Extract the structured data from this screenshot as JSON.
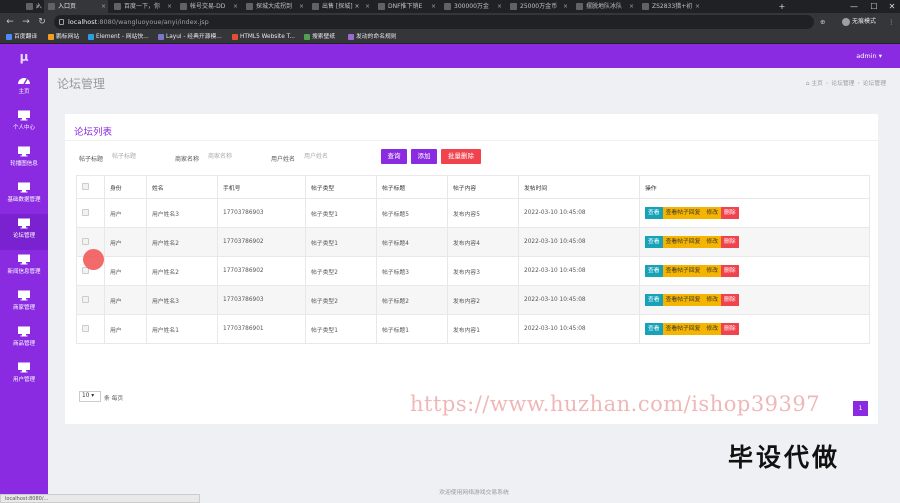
{
  "browser": {
    "tabs": [
      {
        "label": "入口页",
        "active": false
      },
      {
        "label": "入口页",
        "active": true
      },
      {
        "label": "百度一下，你",
        "active": false
      },
      {
        "label": "帐号交易-DD",
        "active": false
      },
      {
        "label": "探城大成拐到",
        "active": false
      },
      {
        "label": "出售 [探城] ×",
        "active": false
      },
      {
        "label": "DNF推下销E",
        "active": false
      },
      {
        "label": "300000万金",
        "active": false
      },
      {
        "label": "25000万金币",
        "active": false
      },
      {
        "label": "摆脱地队冰队",
        "active": false
      },
      {
        "label": "ZS2833猎+初",
        "active": false
      }
    ],
    "url_host": "localhost",
    "url_path": ":8080/wangluoyoue/anyi/index.jsp",
    "profile_label": "无痕模式",
    "bookmarks": [
      "百度翻译",
      "鹏标网站",
      "Element - 网站快...",
      "Layui - 经典开源模...",
      "HTML5 Website T...",
      "搜索壁纸",
      "发动的命名规则"
    ]
  },
  "sidebar": {
    "brand": "μ",
    "items": [
      {
        "label": "主页",
        "icon": "dashboard-icon"
      },
      {
        "label": "个人中心",
        "icon": "monitor-icon"
      },
      {
        "label": "轮播图信息",
        "icon": "monitor-icon"
      },
      {
        "label": "基础数据管理",
        "icon": "monitor-icon"
      },
      {
        "label": "论坛管理",
        "icon": "monitor-icon"
      },
      {
        "label": "新闻信息管理",
        "icon": "monitor-icon"
      },
      {
        "label": "商家管理",
        "icon": "monitor-icon"
      },
      {
        "label": "商品管理",
        "icon": "monitor-icon"
      },
      {
        "label": "用户管理",
        "icon": "monitor-icon"
      }
    ]
  },
  "header": {
    "admin_label": "admin ▾",
    "page_title": "论坛管理",
    "breadcrumb": [
      "主页",
      "论坛管理",
      "论坛管理"
    ]
  },
  "panel": {
    "title": "论坛列表",
    "filters": [
      {
        "label": "帖子标题",
        "placeholder": "帖子标题"
      },
      {
        "label": "商家名称",
        "placeholder": "商家名称"
      },
      {
        "label": "用户姓名",
        "placeholder": "用户姓名"
      }
    ],
    "buttons": {
      "search": "查询",
      "add": "添加",
      "batch_delete": "批量删除"
    }
  },
  "table": {
    "columns": [
      "",
      "身份",
      "姓名",
      "手机号",
      "帖子类型",
      "帖子标题",
      "帖子内容",
      "发帖时间",
      "操作"
    ],
    "rows": [
      {
        "role": "用户",
        "name": "用户姓名3",
        "phone": "17703786903",
        "type": "帖子类型1",
        "title": "帖子标题5",
        "content": "发布内容5",
        "time": "2022-03-10 10:45:08"
      },
      {
        "role": "用户",
        "name": "用户姓名2",
        "phone": "17703786902",
        "type": "帖子类型1",
        "title": "帖子标题4",
        "content": "发布内容4",
        "time": "2022-03-10 10:45:08"
      },
      {
        "role": "用户",
        "name": "用户姓名2",
        "phone": "17703786902",
        "type": "帖子类型2",
        "title": "帖子标题3",
        "content": "发布内容3",
        "time": "2022-03-10 10:45:08"
      },
      {
        "role": "用户",
        "name": "用户姓名3",
        "phone": "17703786903",
        "type": "帖子类型2",
        "title": "帖子标题2",
        "content": "发布内容2",
        "time": "2022-03-10 10:45:08"
      },
      {
        "role": "用户",
        "name": "用户姓名1",
        "phone": "17703786901",
        "type": "帖子类型1",
        "title": "帖子标题1",
        "content": "发布内容1",
        "time": "2022-03-10 10:45:08"
      }
    ],
    "actions": {
      "view": "查看",
      "reply": "查看帖子回复",
      "edit": "修改",
      "delete": "删除"
    }
  },
  "pagination": {
    "page_size": "10",
    "per_page_label": "条 每页",
    "current_page": "1"
  },
  "footer": "欢迎使用网络游戏交易系统",
  "watermark": "https://www.huzhan.com/ishop39397",
  "overlay_text": "毕设代做",
  "colors": {
    "accent": "#8a2be2",
    "danger": "#f0434e",
    "info": "#17a2b8",
    "warning": "#f5b400"
  }
}
